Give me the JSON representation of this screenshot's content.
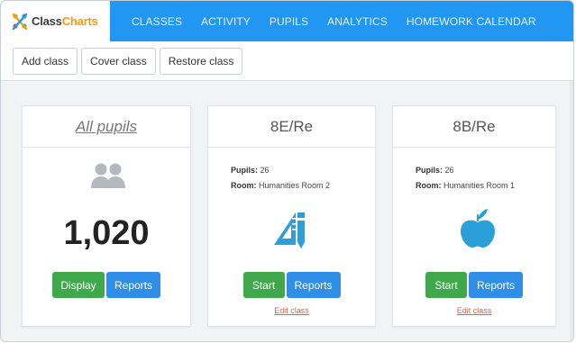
{
  "app": {
    "logo_part1": "Class",
    "logo_part2": "Charts"
  },
  "nav": {
    "items": [
      {
        "label": "CLASSES"
      },
      {
        "label": "ACTIVITY"
      },
      {
        "label": "PUPILS"
      },
      {
        "label": "ANALYTICS"
      },
      {
        "label": "HOMEWORK CALENDAR"
      }
    ]
  },
  "toolbar": {
    "add_class": "Add class",
    "cover_class": "Cover class",
    "restore_class": "Restore class"
  },
  "cards": {
    "all_pupils": {
      "title": "All pupils",
      "count": "1,020",
      "display_label": "Display",
      "reports_label": "Reports",
      "icon": "users-icon"
    },
    "class_8e": {
      "title": "8E/Re",
      "pupils_label": "Pupils:",
      "pupils_value": "26",
      "room_label": "Room:",
      "room_value": "Humanities Room 2",
      "start_label": "Start",
      "reports_label": "Reports",
      "edit_label": "Edit class",
      "icon": "ruler-pencil-icon"
    },
    "class_8b": {
      "title": "8B/Re",
      "pupils_label": "Pupils:",
      "pupils_value": "26",
      "room_label": "Room:",
      "room_value": "Humanities Room 1",
      "start_label": "Start",
      "reports_label": "Reports",
      "edit_label": "Edit class",
      "icon": "apple-icon"
    }
  },
  "colors": {
    "nav_bg": "#2196f3",
    "start_green": "#3fa84b",
    "reports_blue": "#2f8fe6",
    "edit_link": "#e8603c",
    "class_icon": "#2a9fd8"
  }
}
